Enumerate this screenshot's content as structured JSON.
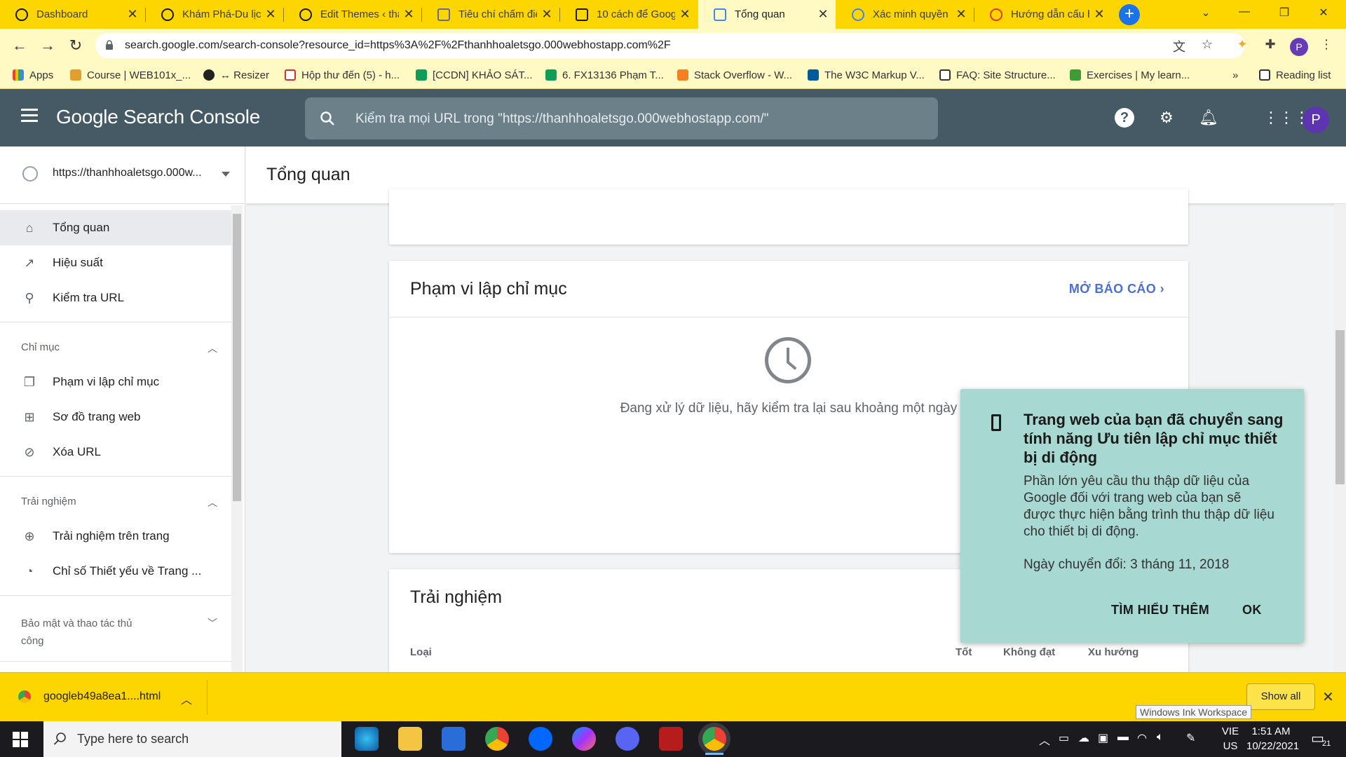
{
  "browser": {
    "tabs": [
      {
        "title": "Dashboard",
        "active": false
      },
      {
        "title": "Khám Phá-Du lịch",
        "active": false
      },
      {
        "title": "Edit Themes ‹ tha",
        "active": false
      },
      {
        "title": "Tiêu chí chấm điể",
        "active": false
      },
      {
        "title": "10 cách để Googl",
        "active": false
      },
      {
        "title": "Tổng quan",
        "active": true
      },
      {
        "title": "Xác minh quyền s",
        "active": false
      },
      {
        "title": "Hướng dẫn cấu h",
        "active": false
      }
    ],
    "url": "search.google.com/search-console?resource_id=https%3A%2F%2Fthanhhoaletsgo.000webhostapp.com%2F",
    "profile_initial": "P",
    "bookmarks": [
      "Apps",
      "Course | WEB101x_...",
      "↔ Resizer",
      "Hộp thư đến (5) - h...",
      "[CCDN] KHẢO SÁT...",
      "6. FX13136 Phạm T...",
      "Stack Overflow - W...",
      "The W3C Markup V...",
      "FAQ: Site Structure...",
      "Exercises | My learn..."
    ],
    "bookmarks_overflow": "»",
    "reading_list": "Reading list"
  },
  "gsc": {
    "logo": "Google Search Console",
    "search_placeholder": "Kiểm tra mọi URL trong \"https://thanhhoaletsgo.000webhostapp.com/\"",
    "avatar_initial": "P"
  },
  "sidebar": {
    "property": "https://thanhhoaletsgo.000w...",
    "items_top": [
      {
        "label": "Tổng quan",
        "icon": "home-icon",
        "active": true
      },
      {
        "label": "Hiệu suất",
        "icon": "trending-up-icon",
        "active": false
      },
      {
        "label": "Kiểm tra URL",
        "icon": "search-icon",
        "active": false
      }
    ],
    "section_index": "Chỉ mục",
    "items_index": [
      {
        "label": "Phạm vi lập chỉ mục",
        "icon": "copy-icon"
      },
      {
        "label": "Sơ đồ trang web",
        "icon": "sitemap-icon"
      },
      {
        "label": "Xóa URL",
        "icon": "eye-off-icon"
      }
    ],
    "section_experience": "Trải nghiệm",
    "items_experience": [
      {
        "label": "Trải nghiệm trên trang",
        "icon": "plus-circle-icon"
      },
      {
        "label": "Chỉ số Thiết yếu về Trang ...",
        "icon": "gauge-icon"
      }
    ],
    "section_security": "Bảo mật và thao tác thủ công"
  },
  "main": {
    "page_title": "Tổng quan",
    "coverage_card": {
      "title": "Phạm vi lập chỉ mục",
      "open_report": "MỞ BÁO CÁO",
      "message": "Đang xử lý dữ liệu, hãy kiểm tra lại sau khoảng một ngày"
    },
    "experience_card": {
      "title": "Trải nghiệm",
      "columns": [
        "Loại",
        "Tốt",
        "Không đạt",
        "Xu hướng"
      ]
    }
  },
  "popup": {
    "title": "Trang web của bạn đã chuyển sang tính năng Ưu tiên lập chỉ mục thiết bị di động",
    "body": "Phần lớn yêu cầu thu thập dữ liệu của Google đối với trang web của bạn sẽ được thực hiện bằng trình thu thập dữ liệu cho thiết bị di động.",
    "date": "Ngày chuyển đổi: 3 tháng 11, 2018",
    "learn_more": "TÌM HIỂU THÊM",
    "ok": "OK",
    "bg_color": "#a8d8d2"
  },
  "downloads": {
    "file": "googleb49a8ea1....html",
    "show_all": "Show all",
    "tooltip": "Windows Ink Workspace"
  },
  "taskbar": {
    "search_placeholder": "Type here to search",
    "lang_top": "VIE",
    "lang_bottom": "US",
    "time": "1:51 AM",
    "date": "10/22/2021",
    "notifications": "21"
  }
}
